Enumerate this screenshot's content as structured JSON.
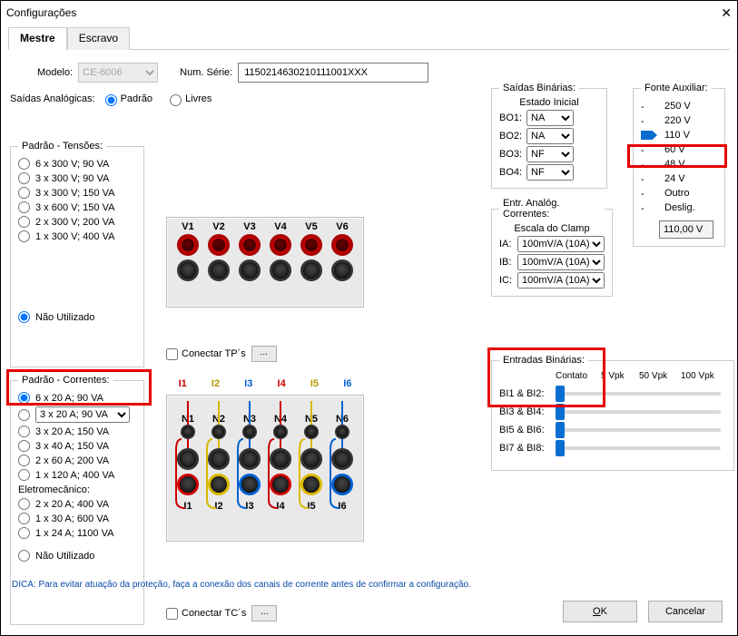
{
  "window": {
    "title": "Configurações"
  },
  "tabs": {
    "master": "Mestre",
    "slave": "Escravo"
  },
  "model": {
    "label": "Modelo:",
    "value": "CE-6006"
  },
  "serial": {
    "label": "Num. Série:",
    "value": "1150214630210111001XXX"
  },
  "saidas_analog": {
    "label": "Saídas Analógicas:",
    "padrao": "Padrão",
    "livres": "Livres"
  },
  "tensoes": {
    "legend": "Padrão - Tensões:",
    "opts": [
      "6 x 300 V; 90 VA",
      "3 x 300 V; 90 VA",
      "3 x 300 V; 150 VA",
      "3 x 600 V; 150 VA",
      "2 x 300 V; 200 VA",
      "1 x 300 V; 400 VA"
    ],
    "nao_utilizado": "Não Utilizado",
    "v_labels": [
      "V1",
      "V2",
      "V3",
      "V4",
      "V5",
      "V6"
    ],
    "conectar_tp": "Conectar TP´s"
  },
  "correntes": {
    "legend": "Padrão - Correntes:",
    "opts": [
      "6 x 20 A; 90 VA",
      "3 x 20 A; 90 VA",
      "3 x 20 A; 150 VA",
      "3 x 40 A; 150 VA",
      "2 x 60 A; 200 VA",
      "1 x 120 A; 400 VA"
    ],
    "eletro_label": "Eletromecânico:",
    "eletro_opts": [
      "2 x 20 A; 400 VA",
      "1 x 30 A; 600 VA",
      "1 x 24 A; 1100 VA"
    ],
    "nao_utilizado": "Não Utilizado",
    "n_labels": [
      "N1",
      "N2",
      "N3",
      "N4",
      "N5",
      "N6"
    ],
    "i_labels": [
      "I1",
      "I2",
      "I3",
      "I4",
      "I5",
      "I6"
    ],
    "conectar_tc": "Conectar TC´s"
  },
  "saidas_bin": {
    "legend": "Saídas Binárias:",
    "estado_inicial": "Estado Inicial",
    "rows": [
      {
        "label": "BO1:",
        "val": "NA"
      },
      {
        "label": "BO2:",
        "val": "NA"
      },
      {
        "label": "BO3:",
        "val": "NF"
      },
      {
        "label": "BO4:",
        "val": "NF"
      }
    ]
  },
  "fonte": {
    "legend": "Fonte Auxiliar:",
    "opts": [
      "250 V",
      "220 V",
      "110 V",
      "60 V",
      "48 V",
      "24 V",
      "Outro",
      "Deslig."
    ],
    "selected_index": 2,
    "value": "110,00 V"
  },
  "analog_in": {
    "legend": "Entr. Analóg. Correntes:",
    "escala": "Escala do Clamp",
    "rows": [
      {
        "label": "IA:",
        "val": "100mV/A (10A)"
      },
      {
        "label": "IB:",
        "val": "100mV/A (10A)"
      },
      {
        "label": "IC:",
        "val": "100mV/A (10A)"
      }
    ]
  },
  "entradas": {
    "legend": "Entradas Binárias:",
    "headers": [
      "",
      "Contato",
      "5 Vpk",
      "50 Vpk",
      "100 Vpk"
    ],
    "rows": [
      "BI1 & BI2:",
      "BI3 & BI4:",
      "BI5 & BI6:",
      "BI7 & BI8:"
    ]
  },
  "tip": "DICA: Para evitar atuação da proteção, faça a conexão dos canais de corrente antes de confirmar a configuração.",
  "buttons": {
    "ok": "OK",
    "cancel": "Cancelar"
  },
  "dots": "..."
}
